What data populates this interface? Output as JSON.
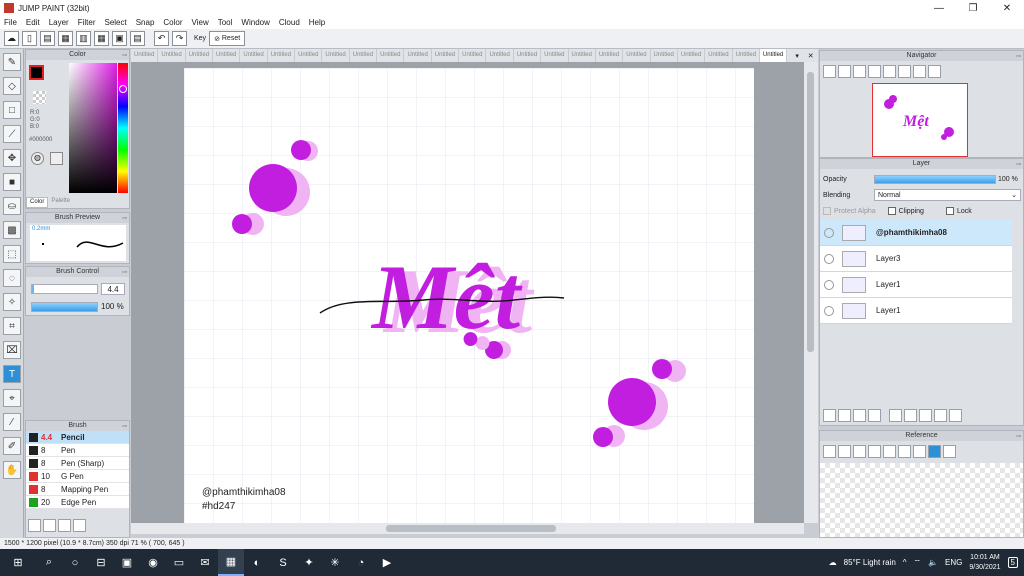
{
  "window": {
    "title": "JUMP PAINT (32bit)"
  },
  "menu": [
    "File",
    "Edit",
    "Layer",
    "Filter",
    "Select",
    "Snap",
    "Color",
    "View",
    "Tool",
    "Window",
    "Cloud",
    "Help"
  ],
  "toolbar": {
    "key_label": "Key",
    "reset_label": "Reset"
  },
  "color_panel": {
    "title": "Color",
    "r": "R:0",
    "g": "G:0",
    "b": "B:0",
    "hex": "#000000",
    "tab_color": "Color",
    "tab_palette": "Palette",
    "current_color": "#000000"
  },
  "brush_preview": {
    "title": "Brush Preview",
    "size": "0.2mm"
  },
  "brush_control": {
    "title": "Brush Control",
    "size_value": "4.4",
    "opacity_value": "100 %",
    "opacity_fraction": 1.0
  },
  "brush_list": {
    "title": "Brush",
    "items": [
      {
        "size": "4.4",
        "name": "Pencil",
        "color": "#222222",
        "selected": true
      },
      {
        "size": "8",
        "name": "Pen",
        "color": "#222222"
      },
      {
        "size": "8",
        "name": "Pen (Sharp)",
        "color": "#222222"
      },
      {
        "size": "10",
        "name": "G Pen",
        "color": "#e03030"
      },
      {
        "size": "8",
        "name": "Mapping Pen",
        "color": "#e03030"
      },
      {
        "size": "20",
        "name": "Edge Pen",
        "color": "#20a020"
      }
    ]
  },
  "tabs": {
    "items": [
      "Untitled",
      "Untitled",
      "Untitled",
      "Untitled",
      "Untitled",
      "Untitled",
      "Untitled",
      "Untitled",
      "Untitled",
      "Untitled",
      "Untitled",
      "Untitled",
      "Untitled",
      "Untitled",
      "Untitled",
      "Untitled",
      "Untitled",
      "Untitled",
      "Untitled",
      "Untitled",
      "Untitled",
      "Untitled",
      "Untitled"
    ],
    "active_label": "Untitled"
  },
  "canvas": {
    "main_text": "Mệt",
    "credit_line1": "@phamthikimha08",
    "credit_line2": "#hd247",
    "accent": "#c21ee0",
    "shadow": "#f0b4f5"
  },
  "navigator": {
    "title": "Navigator"
  },
  "layer_panel": {
    "title": "Layer",
    "opacity_label": "Opacity",
    "opacity_value": "100 %",
    "blending_label": "Blending",
    "blending_value": "Normal",
    "protect_alpha": "Protect Alpha",
    "clipping": "Clipping",
    "lock": "Lock",
    "layers": [
      {
        "name": "@phamthikimha08",
        "selected": true
      },
      {
        "name": "Layer3"
      },
      {
        "name": "Layer1"
      },
      {
        "name": "Layer1"
      }
    ]
  },
  "reference": {
    "title": "Reference"
  },
  "status": {
    "text": "1500 * 1200 pixel   (10.9 * 8.7cm)   350 dpi   71 %   ( 700, 645 )"
  },
  "taskbar": {
    "weather": "85°F  Light rain",
    "lang": "ENG",
    "time": "10:01 AM",
    "date": "9/30/2021",
    "notifications": "5"
  }
}
